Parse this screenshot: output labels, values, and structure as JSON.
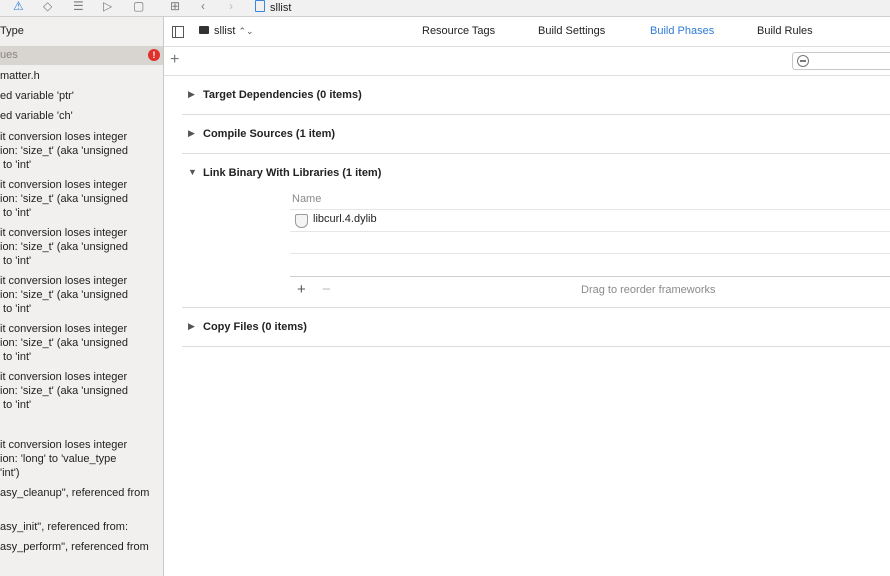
{
  "topbar": {
    "icons": [
      "warning-icon",
      "breakpoint-icon",
      "list-icon",
      "tag-icon",
      "comment-icon",
      "grid-icon",
      "back-icon",
      "forward-icon"
    ],
    "jump_file": "sllist"
  },
  "issues": {
    "header": "Type",
    "group_label": "ues",
    "error_badge": "!",
    "items": [
      "matter.h",
      "ed variable 'ptr'",
      "ed variable 'ch'",
      "it conversion loses integer\nion: 'size_t' (aka 'unsigned\n to 'int'",
      "it conversion loses integer\nion: 'size_t' (aka 'unsigned\n to 'int'",
      "it conversion loses integer\nion: 'size_t' (aka 'unsigned\n to 'int'",
      "it conversion loses integer\nion: 'size_t' (aka 'unsigned\n to 'int'",
      "it conversion loses integer\nion: 'size_t' (aka 'unsigned\n to 'int'",
      "it conversion loses integer\nion: 'size_t' (aka 'unsigned\n to 'int'",
      "it conversion loses integer\nion: 'long' to 'value_type\n'int')",
      "asy_cleanup\", referenced from",
      "asy_init\", referenced from:",
      "asy_perform\", referenced from"
    ]
  },
  "editor": {
    "target": "sllist",
    "target_chevron": "⌃⌄",
    "tabs": [
      "Resource Tags",
      "Build Settings",
      "Build Phases",
      "Build Rules"
    ],
    "active_tab": "Build Phases",
    "add_label": "+",
    "phases": [
      {
        "title": "Target Dependencies (0 items)",
        "expanded": false
      },
      {
        "title": "Compile Sources (1 item)",
        "expanded": false
      },
      {
        "title": "Link Binary With Libraries (1 item)",
        "expanded": true
      },
      {
        "title": "Copy Files (0 items)",
        "expanded": false
      }
    ],
    "libraries": {
      "column_header": "Name",
      "items": [
        "libcurl.4.dylib"
      ],
      "add": "+",
      "remove": "−",
      "hint": "Drag to reorder frameworks"
    }
  }
}
